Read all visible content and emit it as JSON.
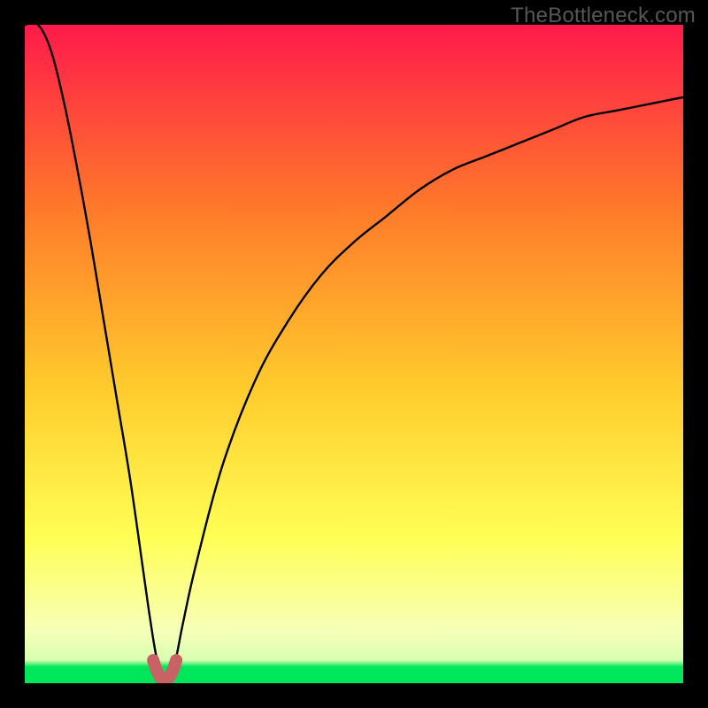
{
  "watermark": {
    "text": "TheBottleneck.com"
  },
  "colors": {
    "top": "#ff1a4b",
    "mid_upper": "#ff7a2a",
    "mid": "#ffcb2c",
    "mid_lower": "#ffff55",
    "pale": "#f7ffb8",
    "green": "#00e65a",
    "curve": "#000000",
    "marker": "#c96265"
  },
  "chart_data": {
    "type": "line",
    "title": "",
    "xlabel": "",
    "ylabel": "",
    "xlim": [
      0,
      100
    ],
    "ylim": [
      0,
      100
    ],
    "grid": false,
    "annotations": [],
    "description": "Bottleneck curve: y (bottleneck %) vs relative component performance x. Minimum near x≈21 where bottleneck ≈0; rises steeply toward 100 as x→0 and asymptotically toward ~90 as x→100.",
    "series": [
      {
        "name": "bottleneck-curve",
        "x": [
          0,
          2,
          4,
          6,
          8,
          10,
          12,
          14,
          16,
          18,
          19,
          20,
          21,
          22,
          23,
          24,
          26,
          30,
          35,
          40,
          45,
          50,
          55,
          60,
          65,
          70,
          75,
          80,
          85,
          90,
          95,
          100
        ],
        "values": [
          100,
          100,
          96,
          88,
          78,
          67,
          55,
          43,
          31,
          17,
          10,
          4,
          1,
          1,
          4,
          9,
          18,
          33,
          46,
          55,
          62,
          67,
          71,
          75,
          78,
          80,
          82,
          84,
          86,
          87,
          88,
          89
        ]
      },
      {
        "name": "optimal-marker",
        "x": [
          19.5,
          20,
          20.5,
          21,
          21.5,
          22,
          22.5,
          23
        ],
        "values": [
          3.5,
          2,
          1,
          0.5,
          0.5,
          1,
          2,
          3.5
        ]
      }
    ]
  }
}
